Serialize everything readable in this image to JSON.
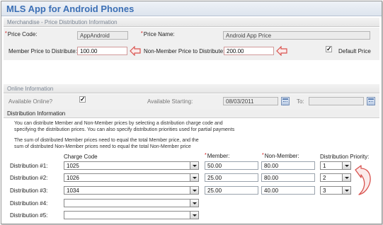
{
  "app": {
    "title": "MLS App for Android Phones"
  },
  "merchandise": {
    "section_title": "Merchandise - Price Distribution Information",
    "price_code_label": "Price Code:",
    "price_code_value": "AppAndroid",
    "price_name_label": "Price Name:",
    "price_name_value": "Android App Price",
    "member_price_label": "Member Price to Distribute:",
    "member_price_value": "100.00",
    "nonmember_price_label": "Non-Member Price to Distribute:",
    "nonmember_price_value": "200.00",
    "default_price_label": "Default Price",
    "default_price_checked": true,
    "required_marker": "*"
  },
  "online": {
    "section_title": "Online Information",
    "available_online_label": "Available Online?",
    "available_online_checked": true,
    "available_starting_label": "Available Starting:",
    "available_starting_value": "08/03/2011",
    "to_label": "To:",
    "to_value": ""
  },
  "distribution": {
    "section_title": "Distribution Information",
    "info_lines": [
      "You can distribute Member and Non-Member prices by selecting a distribution charge code and",
      "specifying the distribution prices. You can also specify distribution priorities used for partial payments",
      "The sum of distributed Member prices need to equal the total Member price, and the",
      "sum of distributed Non-Member prices need to equal the total Non-Member price"
    ],
    "headers": {
      "charge_code": "Charge Code",
      "member": "Member:",
      "nonmember": "Non-Member:",
      "priority": "Distribution Priority:"
    },
    "rows": [
      {
        "label": "Distribution #1:",
        "charge_code": "1025",
        "member": "50.00",
        "nonmember": "80.00",
        "priority": "1"
      },
      {
        "label": "Distribution #2:",
        "charge_code": "1026",
        "member": "25.00",
        "nonmember": "80.00",
        "priority": "2"
      },
      {
        "label": "Distribution #3:",
        "charge_code": "1034",
        "member": "25.00",
        "nonmember": "40.00",
        "priority": "3"
      },
      {
        "label": "Distribution #4:",
        "charge_code": "",
        "member": "",
        "nonmember": "",
        "priority": ""
      },
      {
        "label": "Distribution #5:",
        "charge_code": "",
        "member": "",
        "nonmember": "",
        "priority": ""
      }
    ]
  },
  "colors": {
    "title": "#3b6fb5",
    "required": "#cc0000",
    "annotation_arrow": "#d9534f"
  },
  "icons": [
    "calendar-icon",
    "dropdown-arrow-icon",
    "checkbox-check-icon",
    "annotation-arrow-icon"
  ]
}
